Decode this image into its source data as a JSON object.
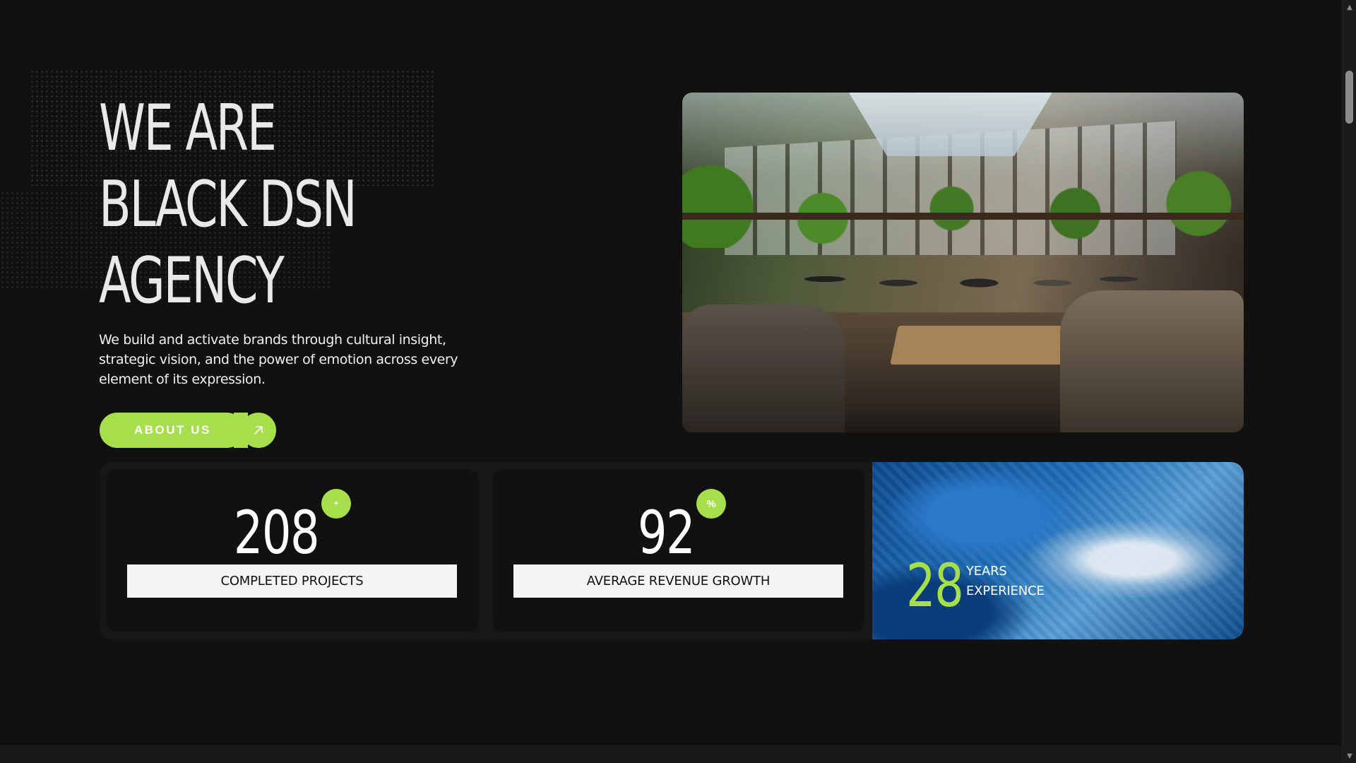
{
  "hero": {
    "title_lines": [
      "WE ARE",
      "BLACK DSN",
      "AGENCY"
    ],
    "description": "We build and activate brands through cultural insight, strategic vision, and the power of emotion across every element of its expression.",
    "cta_label": "ABOUT US",
    "cta_icon": "arrow-up-right-icon",
    "image_icon": "office-team-photo"
  },
  "stats": [
    {
      "value": "208",
      "badge": "+",
      "label": "COMPLETED PROJECTS"
    },
    {
      "value": "92",
      "badge": "%",
      "label": "AVERAGE REVENUE GROWTH"
    }
  ],
  "experience": {
    "value": "28",
    "label_line1": "YEARS",
    "label_line2": "EXPERIENCE"
  },
  "scrollbar": {
    "up_glyph": "▲",
    "down_glyph": "▼"
  },
  "colors": {
    "background": "#111111",
    "accent": "#a7df4c",
    "label_bg": "#f4f4f4"
  }
}
